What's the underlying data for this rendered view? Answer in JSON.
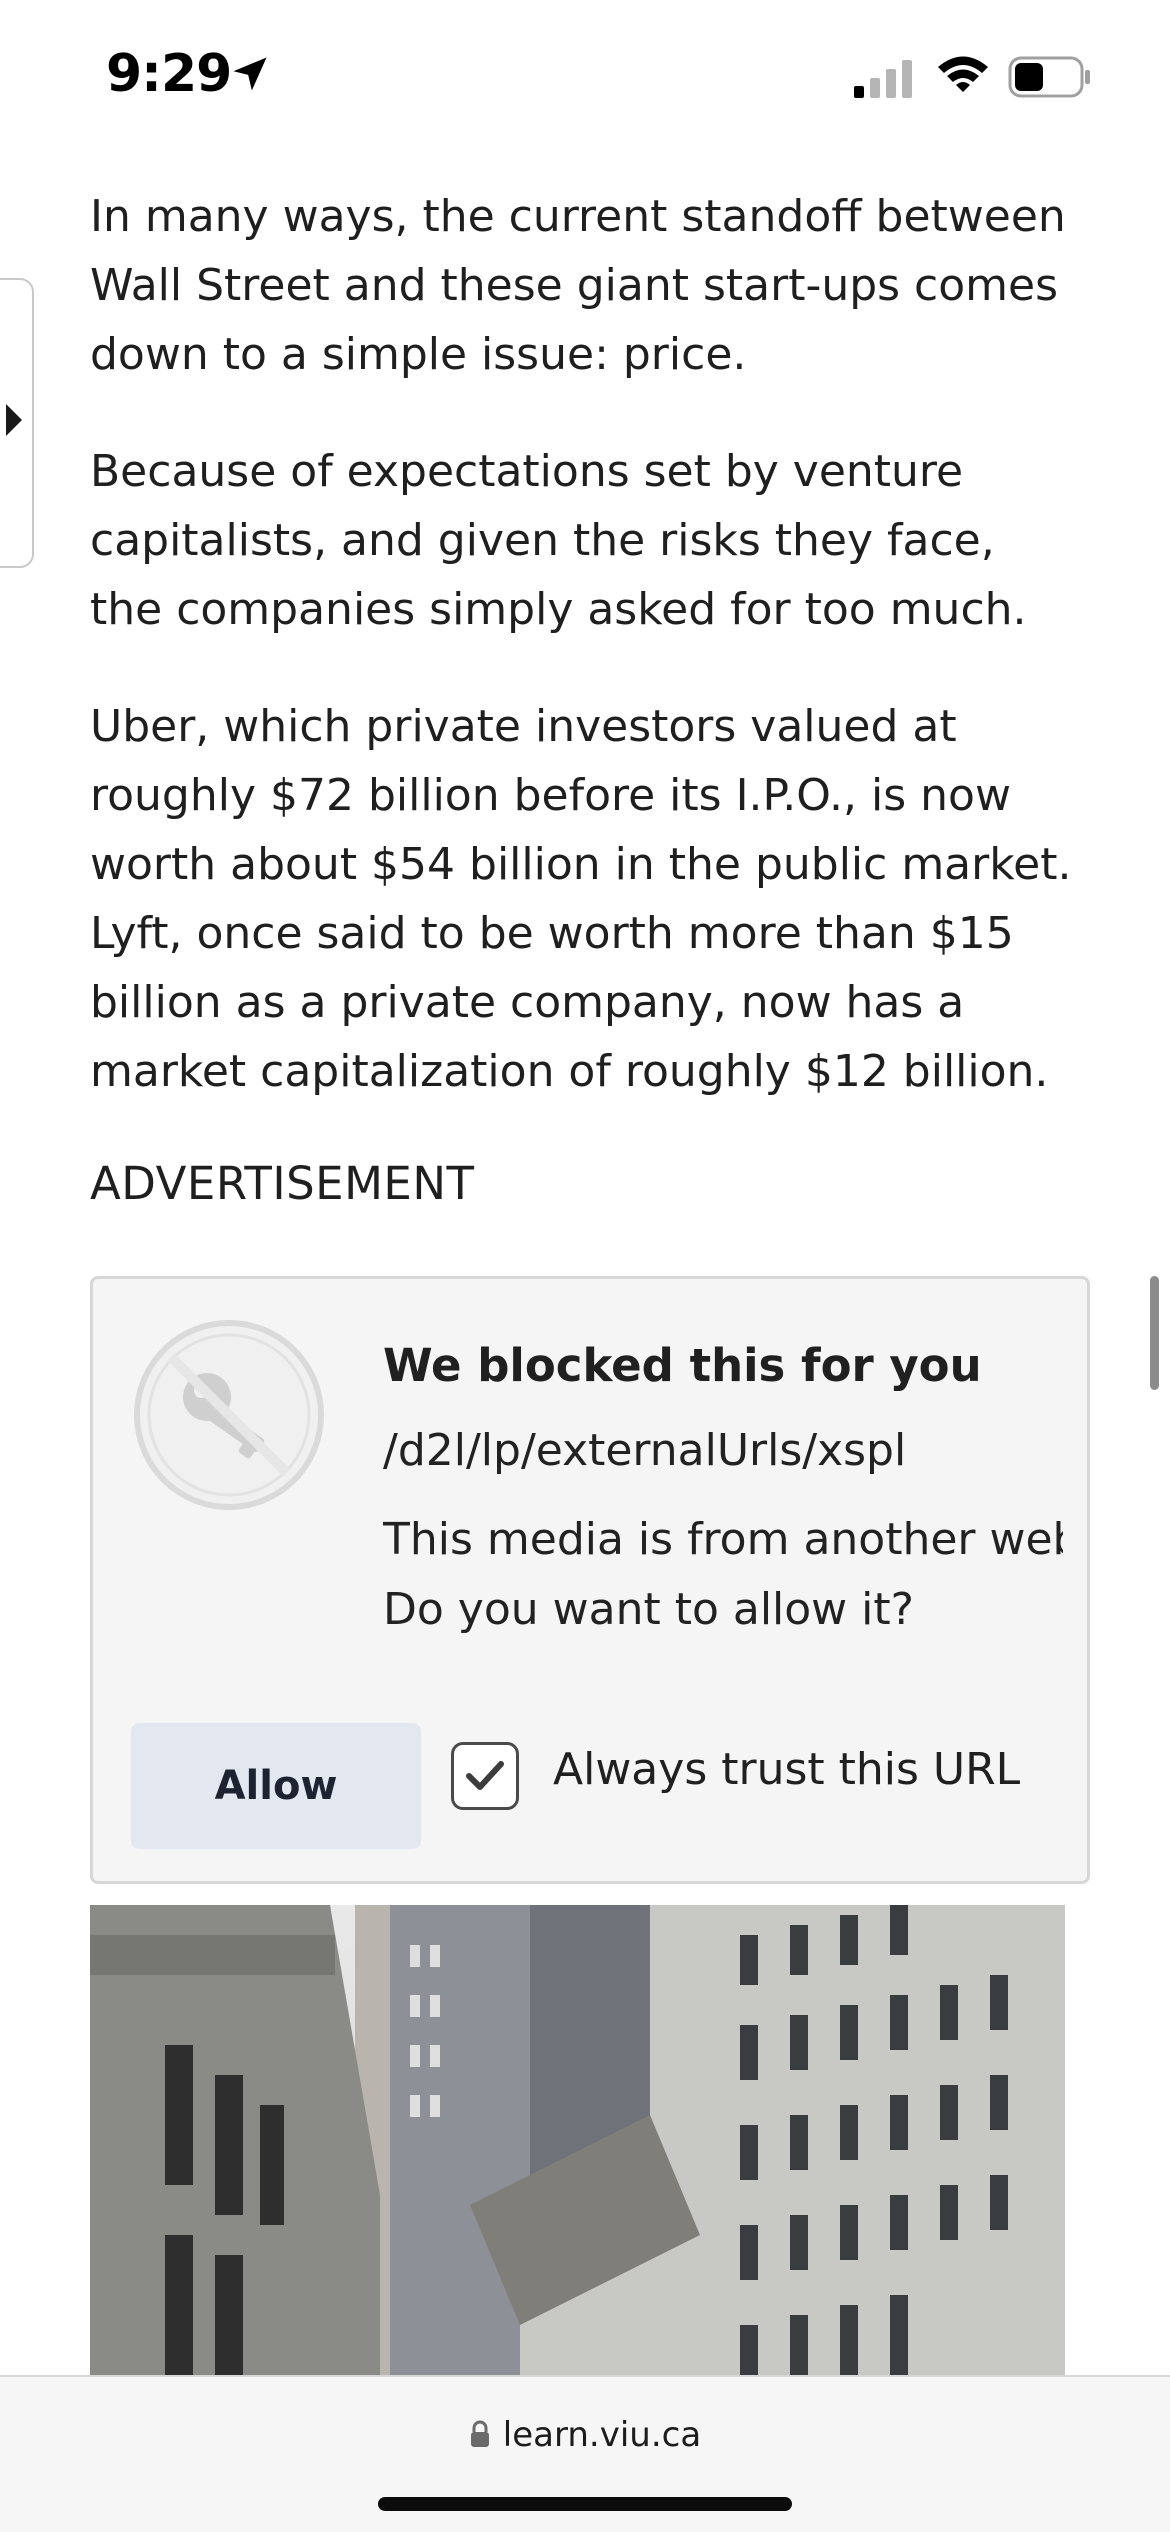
{
  "status_bar": {
    "time": "9:29",
    "icons": [
      "location-arrow-icon",
      "cellular-signal-icon",
      "wifi-icon",
      "battery-icon"
    ]
  },
  "article": {
    "paragraphs": [
      "In many ways, the current standoff between Wall Street and these giant start-ups comes down to a simple issue: price.",
      "Because of expectations set by venture capitalists, and given the risks they face, the companies simply asked for too much.",
      "Uber, which private investors valued at roughly $72 billion before its I.P.O., is now worth about $54 billion in the public market. Lyft, once said to be worth more than $15 billion as a private company, now has a market capitalization of roughly $12 billion."
    ],
    "ad_label": "ADVERTISEMENT"
  },
  "blocked_media": {
    "title": "We blocked this for you",
    "url": "/d2l/lp/externalUrls/xspl",
    "description_line1": "This media is from another webs",
    "description_line2": "Do you want to allow it?",
    "allow_button": "Allow",
    "trust_label": "Always trust this URL",
    "trust_checked": true,
    "icon": "blocked-key-icon"
  },
  "bottom_bar": {
    "domain": "learn.viu.ca",
    "icon": "lock-icon"
  },
  "colors": {
    "allow_button_bg": "#e3e8f0",
    "box_bg": "#f5f5f5",
    "text": "#1f1f1f"
  }
}
